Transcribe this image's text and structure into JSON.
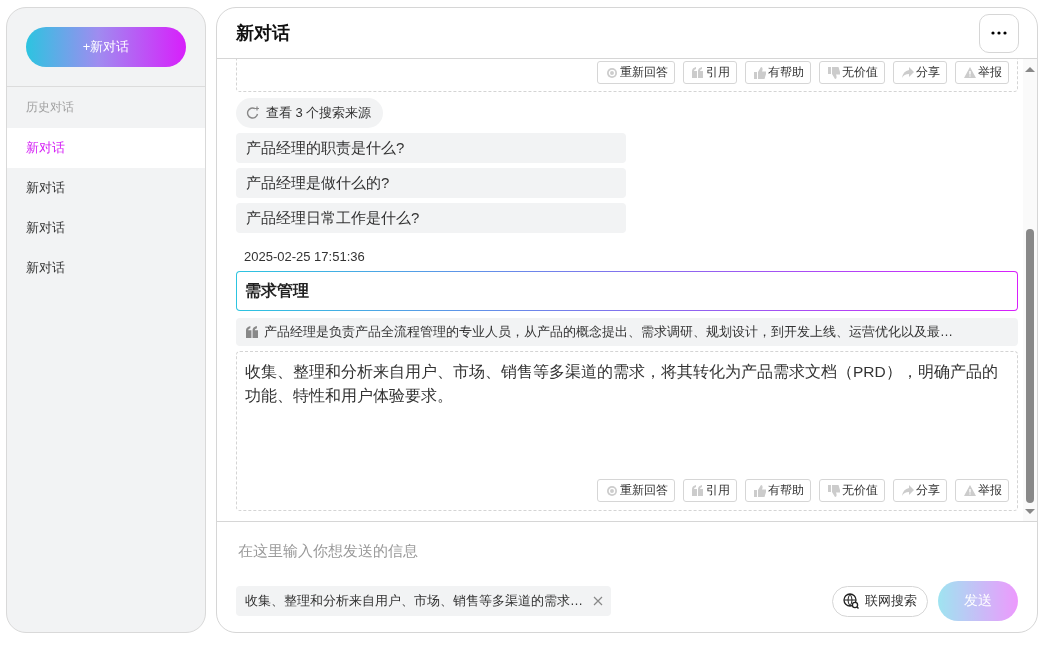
{
  "sidebar": {
    "new_chat_button": "+新对话",
    "history_label": "历史对话",
    "items": [
      {
        "label": "新对话",
        "selected": true
      },
      {
        "label": "新对话",
        "selected": false
      },
      {
        "label": "新对话",
        "selected": false
      },
      {
        "label": "新对话",
        "selected": false
      }
    ]
  },
  "header": {
    "title": "新对话"
  },
  "messages": {
    "previous_answer_actions": [
      {
        "kind": "regenerate",
        "label": "重新回答"
      },
      {
        "kind": "quote",
        "label": "引用"
      },
      {
        "kind": "like",
        "label": "有帮助"
      },
      {
        "kind": "dislike",
        "label": "无价值"
      },
      {
        "kind": "share",
        "label": "分享"
      },
      {
        "kind": "report",
        "label": "举报"
      }
    ],
    "sources_button": "查看 3 个搜索来源",
    "suggestions": [
      "产品经理的职责是什么?",
      "产品经理是做什么的?",
      "产品经理日常工作是什么?"
    ],
    "timestamp": "2025-02-25 17:51:36",
    "question": "需求管理",
    "quote": "产品经理是负责产品全流程管理的专业人员，从产品的概念提出、需求调研、规划设计，到开发上线、运营优化以及最…",
    "answer": "收集、整理和分析来自用户、市场、销售等多渠道的需求，将其转化为产品需求文档（PRD），明确产品的功能、特性和用户体验要求。",
    "answer_actions": [
      {
        "kind": "regenerate",
        "label": "重新回答"
      },
      {
        "kind": "quote",
        "label": "引用"
      },
      {
        "kind": "like",
        "label": "有帮助"
      },
      {
        "kind": "dislike",
        "label": "无价值"
      },
      {
        "kind": "share",
        "label": "分享"
      },
      {
        "kind": "report",
        "label": "举报"
      }
    ]
  },
  "composer": {
    "placeholder": "在这里输入你想发送的信息",
    "attachment": "收集、整理和分析来自用户、市场、销售等多渠道的需求…",
    "web_search_button": "联网搜索",
    "send_button": {
      "label": "发送",
      "disabled": true
    }
  }
}
